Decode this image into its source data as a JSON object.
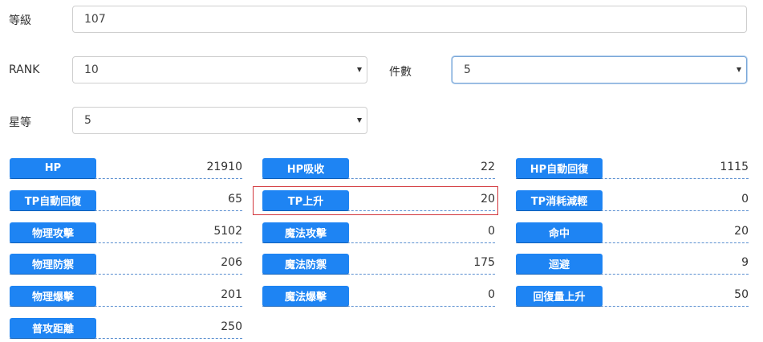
{
  "form": {
    "level": {
      "label": "等級",
      "value": "107"
    },
    "rank": {
      "label": "RANK",
      "value": "10"
    },
    "count": {
      "label": "件數",
      "value": "5"
    },
    "star": {
      "label": "星等",
      "value": "5"
    }
  },
  "stats": {
    "hp": {
      "label": "HP",
      "value": "21910"
    },
    "hp_drain": {
      "label": "HP吸收",
      "value": "22"
    },
    "hp_regen": {
      "label": "HP自動回復",
      "value": "1115"
    },
    "tp_regen": {
      "label": "TP自動回復",
      "value": "65"
    },
    "tp_up": {
      "label": "TP上升",
      "value": "20"
    },
    "tp_reduce": {
      "label": "TP消耗減輕",
      "value": "0"
    },
    "phys_atk": {
      "label": "物理攻擊",
      "value": "5102"
    },
    "mag_atk": {
      "label": "魔法攻擊",
      "value": "0"
    },
    "accuracy": {
      "label": "命中",
      "value": "20"
    },
    "phys_def": {
      "label": "物理防禦",
      "value": "206"
    },
    "mag_def": {
      "label": "魔法防禦",
      "value": "175"
    },
    "dodge": {
      "label": "迴避",
      "value": "9"
    },
    "phys_crit": {
      "label": "物理爆擊",
      "value": "201"
    },
    "mag_crit": {
      "label": "魔法爆擊",
      "value": "0"
    },
    "heal_up": {
      "label": "回復量上升",
      "value": "50"
    },
    "atk_range": {
      "label": "普攻距離",
      "value": "250"
    }
  },
  "colors": {
    "badge": "#1e84f3",
    "dashed_line": "#5a8fd0",
    "highlight_border": "#d2353b",
    "focus_border": "#7aa7d8"
  }
}
